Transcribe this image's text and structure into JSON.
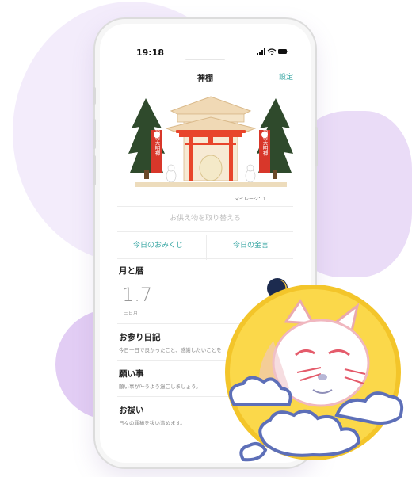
{
  "status_bar": {
    "time": "19:18"
  },
  "nav": {
    "title": "神棚",
    "settings": "設定"
  },
  "shrine": {
    "banner_text": "稲荷大明神",
    "mileage": "マイレージ：1"
  },
  "offering_button": "お供え物を取り替える",
  "tabs": [
    {
      "label": "今日のおみくじ"
    },
    {
      "label": "今日の金言"
    }
  ],
  "moon": {
    "title": "月と暦",
    "day": "1.7",
    "name": "三日月"
  },
  "sections": [
    {
      "title": "お参り日記",
      "subtitle": "今日一日で良かったこと、感謝したいことを"
    },
    {
      "title": "願い事",
      "subtitle": "願い事が叶うよう過ごしましょう。"
    },
    {
      "title": "お祓い",
      "subtitle": "日々の罪穢を祓い清めます。"
    }
  ],
  "colors": {
    "accent": "#37a6a3",
    "torii": "#e8452b",
    "background_blob": "#f3ecfb",
    "mascot_circle": "#fbd84a"
  }
}
